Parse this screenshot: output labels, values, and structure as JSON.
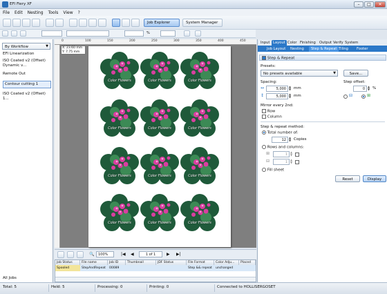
{
  "window": {
    "title": "EFI Fiery XF",
    "minimize": "–",
    "maximize": "□",
    "close": "✕"
  },
  "menu": [
    "File",
    "Edit",
    "Nesting",
    "Tools",
    "View",
    "?"
  ],
  "toolbar": {
    "job_explorer": "Job Explorer",
    "system_manager": "System Manager"
  },
  "toolbar2": {
    "zoom_value": "100%",
    "percent": "%"
  },
  "left_panel": {
    "dropdown": "By Workflow",
    "workflows": [
      "EFI Linearization",
      "ISO Coated v2 (Offset) Dynamic v...",
      "Remote Out",
      "Contour cutting 1",
      "ISO Coated v2 (Offset) 1..."
    ],
    "selected_index": 3,
    "footer": "All Jobs"
  },
  "ruler": {
    "labels": [
      "0",
      "100",
      "150",
      "200",
      "250",
      "300",
      "350",
      "400",
      "450"
    ]
  },
  "coords": {
    "x": "X: 23.60 mm",
    "y": "Y: 7.75 mm"
  },
  "tile_text": "Color Flowers",
  "nav": {
    "zoom": "100%",
    "page": "1 of 1"
  },
  "job_table": {
    "headers": [
      "Job Status",
      "File name",
      "Job ID",
      "Thumbnail",
      "JDF Status",
      "File Format",
      "Color Adju...",
      "Placed"
    ],
    "row": [
      "Spooled",
      "StepAndRepeat",
      "00089",
      "",
      "",
      "Step && repeat",
      "unchanged",
      ""
    ]
  },
  "right_panel": {
    "tabs": [
      "Input",
      "Layout",
      "Color",
      "Finishing",
      "Output",
      "Verify",
      "System"
    ],
    "active_tab": "Layout",
    "subtabs": [
      "Job Layout",
      "Nesting",
      "Step & Repeat",
      "Tiling",
      "Footer"
    ],
    "active_subtab": "Step & Repeat",
    "section_title": "Step & Repeat",
    "presets_label": "Presets:",
    "presets_value": "No presets available",
    "save_button": "Save...",
    "spacing_label": "Spacing:",
    "spacing_h": "5,000",
    "spacing_v": "5,000",
    "unit_mm": "mm",
    "step_offset_label": "Step offset:",
    "step_offset_value": "0",
    "unit_percent": "%",
    "mirror_label": "Mirror every 2nd:",
    "mirror_row": "Row",
    "mirror_column": "Column",
    "method_label": "Step & repeat method:",
    "total_label": "Total number of:",
    "total_value": "12",
    "copies": "Copies",
    "rows_columns": "Rows and columns:",
    "rows_value": "1",
    "cols_value": "1",
    "fill_sheet": "Fill sheet",
    "reset_button": "Reset",
    "display_button": "Display"
  },
  "status": {
    "total": "Total: 5",
    "held": "Held: 5",
    "processing": "Processing: 0",
    "printing": "Printing: 0",
    "connected": "Connected to HOLLISERGOSET"
  }
}
